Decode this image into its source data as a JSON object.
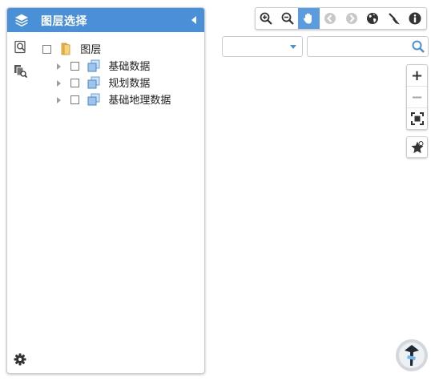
{
  "panel": {
    "title": "图层选择",
    "header_color": "#4a90d9",
    "header_icon": "layers-icon",
    "collapse_icon": "collapse-left-icon",
    "side_tools": [
      "layer-search-icon",
      "layer-query-icon"
    ],
    "settings_icon": "gear-icon"
  },
  "tree": {
    "root": {
      "label": "图层",
      "checked": false,
      "icon": "folder-icon"
    },
    "children": [
      {
        "label": "基础数据",
        "checked": false,
        "icon": "layer-group-icon"
      },
      {
        "label": "规划数据",
        "checked": false,
        "icon": "layer-group-icon"
      },
      {
        "label": "基础地理数据",
        "checked": false,
        "icon": "layer-group-icon"
      }
    ]
  },
  "toolbar": {
    "active_color": "#5b9be0",
    "buttons": [
      {
        "name": "zoom-in-tool",
        "icon": "zoom-in-icon",
        "active": false,
        "enabled": true
      },
      {
        "name": "zoom-out-tool",
        "icon": "zoom-out-icon",
        "active": false,
        "enabled": true
      },
      {
        "name": "pan-tool",
        "icon": "hand-icon",
        "active": true,
        "enabled": true
      },
      {
        "name": "previous-extent",
        "icon": "back-icon",
        "active": false,
        "enabled": false
      },
      {
        "name": "next-extent",
        "icon": "forward-icon",
        "active": false,
        "enabled": false
      },
      {
        "name": "full-extent",
        "icon": "globe-icon",
        "active": false,
        "enabled": true
      },
      {
        "name": "clear-tool",
        "icon": "broom-icon",
        "active": false,
        "enabled": true
      },
      {
        "name": "identify-tool",
        "icon": "info-icon",
        "active": false,
        "enabled": true
      }
    ]
  },
  "search": {
    "dropdown_value": "",
    "input_value": "",
    "placeholder": ""
  },
  "zoom_controls": {
    "zoom_in": "+",
    "zoom_out": "−"
  }
}
